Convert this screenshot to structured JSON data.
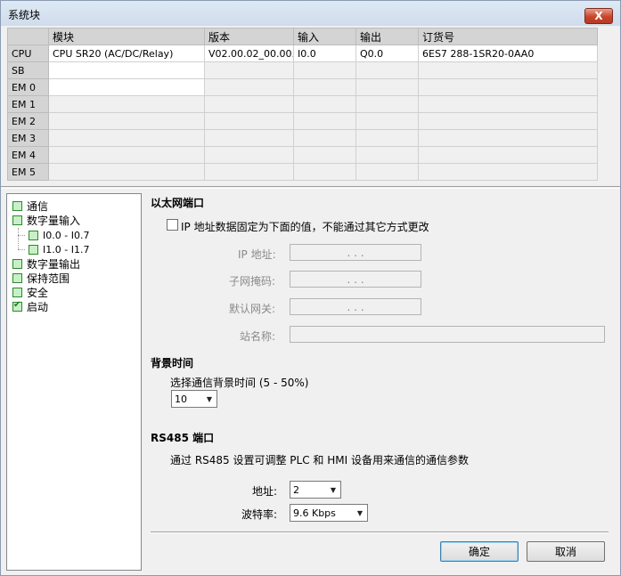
{
  "window": {
    "title": "系统块",
    "close_label": "X"
  },
  "modules": {
    "columns": [
      "",
      "模块",
      "版本",
      "输入",
      "输出",
      "订货号"
    ],
    "rows": [
      [
        "CPU",
        "CPU SR20 (AC/DC/Relay)",
        "V02.00.02_00.00...",
        "I0.0",
        "Q0.0",
        "6ES7 288-1SR20-0AA0"
      ],
      [
        "SB",
        "",
        "",
        "",
        "",
        ""
      ],
      [
        "EM 0",
        "",
        "",
        "",
        "",
        ""
      ],
      [
        "EM 1",
        "",
        "",
        "",
        "",
        ""
      ],
      [
        "EM 2",
        "",
        "",
        "",
        "",
        ""
      ],
      [
        "EM 3",
        "",
        "",
        "",
        "",
        ""
      ],
      [
        "EM 4",
        "",
        "",
        "",
        "",
        ""
      ],
      [
        "EM 5",
        "",
        "",
        "",
        "",
        ""
      ]
    ]
  },
  "tree": {
    "items": [
      {
        "label": "通信",
        "checked": false
      },
      {
        "label": "数字量输入",
        "checked": false
      },
      {
        "label": "I0.0 - I0.7",
        "checked": false
      },
      {
        "label": "I1.0 - I1.7",
        "checked": false
      },
      {
        "label": "数字量输出",
        "checked": false
      },
      {
        "label": "保持范围",
        "checked": false
      },
      {
        "label": "安全",
        "checked": false
      },
      {
        "label": "启动",
        "checked": true
      }
    ]
  },
  "ethernet": {
    "title": "以太网端口",
    "fixed_ip_label": "IP 地址数据固定为下面的值，不能通过其它方式更改",
    "fixed_ip_checked": false,
    "ip_label": "IP 地址:",
    "subnet_label": "子网掩码:",
    "gateway_label": "默认网关:",
    "station_label": "站名称:",
    "ip_dots": ".   .   .",
    "station_value": ""
  },
  "background": {
    "title": "背景时间",
    "select_label": "选择通信背景时间 (5 - 50%)",
    "value": "10"
  },
  "rs485": {
    "title": "RS485 端口",
    "description": "通过 RS485 设置可调整 PLC 和 HMI 设备用来通信的通信参数",
    "address_label": "地址:",
    "address_value": "2",
    "baud_label": "波特率:",
    "baud_value": "9.6 Kbps"
  },
  "buttons": {
    "ok": "确定",
    "cancel": "取消"
  },
  "icons": {
    "close": "close-icon",
    "dropdown": "chevron-down-icon"
  }
}
